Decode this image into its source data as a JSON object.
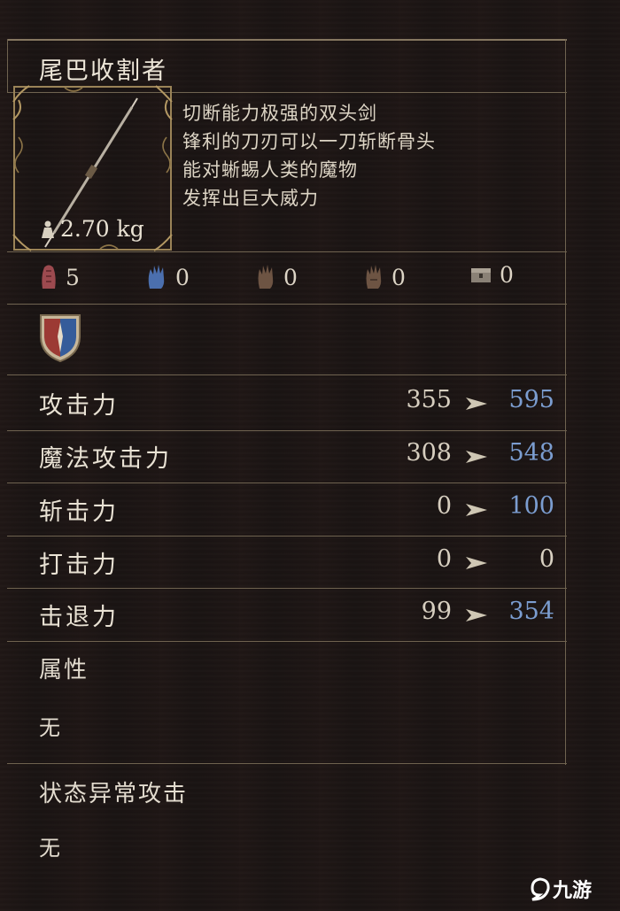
{
  "item": {
    "name": "尾巴收割者",
    "weight": "2.70 kg",
    "description": [
      "切断能力极强的双头剑",
      "锋利的刀刃可以一刀斩断骨头",
      "能对蜥蜴人类的魔物",
      "发挥出巨大威力"
    ]
  },
  "requirements": [
    {
      "icon": "strength-fist-icon",
      "value": "5"
    },
    {
      "icon": "magic-hand-icon",
      "value": "0"
    },
    {
      "icon": "hand-icon",
      "value": "0"
    },
    {
      "icon": "hand-alt-icon",
      "value": "0"
    },
    {
      "icon": "chest-icon",
      "value": "0"
    }
  ],
  "stats": [
    {
      "label": "攻击力",
      "base": "355",
      "value": "595",
      "highlight": true
    },
    {
      "label": "魔法攻击力",
      "base": "308",
      "value": "548",
      "highlight": true
    },
    {
      "label": "斩击力",
      "base": "0",
      "value": "100",
      "highlight": true
    },
    {
      "label": "打击力",
      "base": "0",
      "value": "0",
      "highlight": false
    },
    {
      "label": "击退力",
      "base": "99",
      "value": "354",
      "highlight": true
    }
  ],
  "attribute": {
    "label": "属性",
    "value": "无"
  },
  "status_effect": {
    "label": "状态异常攻击",
    "value": "无"
  },
  "watermark": "九游",
  "colors": {
    "accent_blue": "#7b9dd0",
    "border_gold": "#857760",
    "background": "#1b1514"
  }
}
